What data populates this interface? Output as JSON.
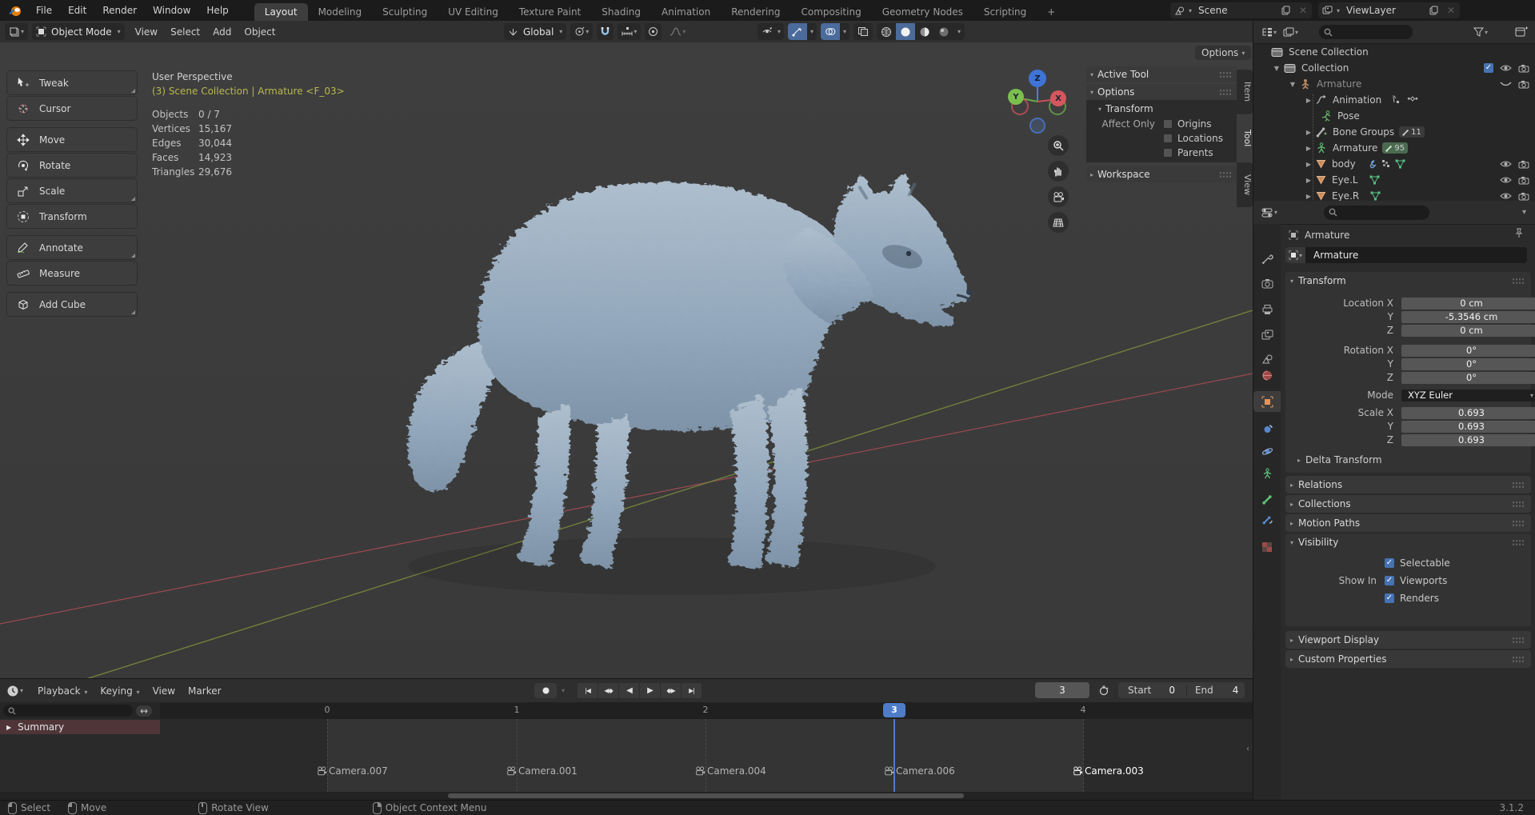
{
  "topbar": {
    "menus": [
      "File",
      "Edit",
      "Render",
      "Window",
      "Help"
    ],
    "tabs": [
      "Layout",
      "Modeling",
      "Sculpting",
      "UV Editing",
      "Texture Paint",
      "Shading",
      "Animation",
      "Rendering",
      "Compositing",
      "Geometry Nodes",
      "Scripting"
    ],
    "active_tab": "Layout",
    "add_tab": "+",
    "scene_label": "Scene",
    "viewlayer_label": "ViewLayer"
  },
  "vheader": {
    "mode": "Object Mode",
    "menus": [
      "View",
      "Select",
      "Add",
      "Object"
    ],
    "orientation": "Global",
    "options": "Options"
  },
  "toolbar": {
    "tools": [
      "Tweak",
      "Cursor",
      "Move",
      "Rotate",
      "Scale",
      "Transform",
      "Annotate",
      "Measure",
      "Add Cube"
    ]
  },
  "viewport": {
    "perspective": "User Perspective",
    "context": "(3) Scene Collection | Armature <F_03>",
    "stats": [
      {
        "label": "Objects",
        "value": "0 / 7"
      },
      {
        "label": "Vertices",
        "value": "15,167"
      },
      {
        "label": "Edges",
        "value": "30,044"
      },
      {
        "label": "Faces",
        "value": "14,923"
      },
      {
        "label": "Triangles",
        "value": "29,676"
      }
    ],
    "gizmo": {
      "x": "X",
      "y": "Y",
      "z": "Z"
    }
  },
  "sidebar": {
    "active_tool": "Active Tool",
    "options": "Options",
    "transform": "Transform",
    "affect_only": "Affect Only",
    "checkboxes": [
      "Origins",
      "Locations",
      "Parents"
    ],
    "workspace": "Workspace",
    "tabs": [
      "Item",
      "Tool",
      "View"
    ]
  },
  "outliner": {
    "rows": [
      {
        "label": "Scene Collection"
      },
      {
        "label": "Collection"
      },
      {
        "label": "Armature"
      },
      {
        "label": "Animation"
      },
      {
        "label": "Pose"
      },
      {
        "label": "Bone Groups",
        "badge": "11"
      },
      {
        "label": "Armature",
        "badge": "95"
      },
      {
        "label": "body"
      },
      {
        "label": "Eye.L"
      },
      {
        "label": "Eye.R"
      }
    ]
  },
  "properties": {
    "breadcrumb": "Armature",
    "name": "Armature",
    "transform": {
      "title": "Transform",
      "rows": [
        {
          "label": "Location X",
          "value": "0 cm"
        },
        {
          "label": "Y",
          "value": "-5.3546 cm"
        },
        {
          "label": "Z",
          "value": "0 cm"
        },
        {
          "label": "Rotation X",
          "value": "0°"
        },
        {
          "label": "Y",
          "value": "0°"
        },
        {
          "label": "Z",
          "value": "0°"
        }
      ],
      "mode_label": "Mode",
      "mode_value": "XYZ Euler",
      "scale_rows": [
        {
          "label": "Scale X",
          "value": "0.693"
        },
        {
          "label": "Y",
          "value": "0.693"
        },
        {
          "label": "Z",
          "value": "0.693"
        }
      ],
      "delta": "Delta Transform"
    },
    "sections": [
      "Relations",
      "Collections",
      "Motion Paths"
    ],
    "visibility": {
      "title": "Visibility",
      "selectable": "Selectable",
      "show_in": "Show In",
      "viewports": "Viewports",
      "renders": "Renders"
    },
    "sections2": [
      "Viewport Display",
      "Custom Properties"
    ]
  },
  "timeline": {
    "menus": [
      "Playback",
      "Keying",
      "View",
      "Marker"
    ],
    "summary": "Summary",
    "ticks": [
      "0",
      "1",
      "2",
      "3",
      "4"
    ],
    "current_frame": "3",
    "start_label": "Start",
    "start_value": "0",
    "end_label": "End",
    "end_value": "4",
    "markers": [
      {
        "name": "Camera.007"
      },
      {
        "name": "Camera.001"
      },
      {
        "name": "Camera.004"
      },
      {
        "name": "Camera.006"
      },
      {
        "name": "Camera.003"
      }
    ]
  },
  "statusbar": {
    "items": [
      "Select",
      "Move",
      "Rotate View",
      "Object Context Menu"
    ],
    "version": "3.1.2"
  }
}
